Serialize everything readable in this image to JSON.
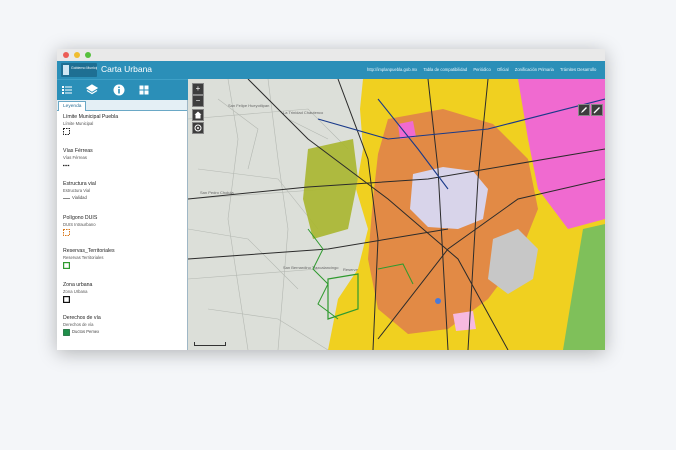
{
  "window": {
    "controls": [
      "close",
      "minimize",
      "maximize"
    ]
  },
  "header": {
    "logo_text": "Gobierno Municipal",
    "title": "Carta Urbana",
    "links": [
      "http://implanpuebla.gob.mx",
      "Tabla de compatibilidad",
      "Periódico",
      "Oficial",
      "Zonificación Primaria",
      "Trámites Desarrollo"
    ]
  },
  "toolbar": {
    "icons": [
      "legend-list-icon",
      "layers-icon",
      "info-icon",
      "basemap-grid-icon"
    ]
  },
  "panel": {
    "tab_label": "Leyenda",
    "sections": [
      {
        "title": "Límite Municipal Puebla",
        "sub": "Límite Municipal",
        "items": [
          {
            "symbol": "dashed-box",
            "label": ""
          }
        ]
      },
      {
        "title": "Vías Férreas",
        "sub": "Vías Férreas",
        "items": [
          {
            "symbol": "rail-line",
            "label": ""
          }
        ]
      },
      {
        "title": "Estructura vial",
        "sub": "Estructura Vial",
        "items": [
          {
            "symbol": "gray-line",
            "label": "Vialidad"
          }
        ]
      },
      {
        "title": "Polígono DUIS",
        "sub": "DUIS Intraurbano",
        "items": [
          {
            "symbol": "orange-dashed-box",
            "label": ""
          }
        ]
      },
      {
        "title": "Reservas_Territoriales",
        "sub": "Reservas Territoriales",
        "items": [
          {
            "symbol": "green-box",
            "label": ""
          }
        ]
      },
      {
        "title": "Zona urbana",
        "sub": "Zona Urbana",
        "items": [
          {
            "symbol": "black-box",
            "label": ""
          }
        ]
      },
      {
        "title": "Derechos de vía",
        "sub": "Derechos de vía",
        "items": [
          {
            "symbol": "green-fill",
            "label": "Ductos Pemex"
          }
        ]
      }
    ]
  },
  "map": {
    "controls": [
      "zoom-in",
      "zoom-out",
      "home",
      "locate"
    ],
    "place_labels": [
      "San Felipe Hueyotlipan",
      "La Trinidad Chautenco",
      "San Pedro Cholula",
      "San Bernardino Tlaxcalancingo",
      "Reserva Territorial"
    ],
    "colors": {
      "commercial": "#f0d020",
      "mixed": "#e28a45",
      "center": "#d8d4ea",
      "industrial": "#f06ad0",
      "preserve": "#a9b62d",
      "basemap": "#d9dcd6",
      "road": "#2b2b2b",
      "railway": "#1a3a8a"
    }
  },
  "colors": {
    "header_bg": "#2b8fb8",
    "panel_border": "#6aa8c6"
  }
}
